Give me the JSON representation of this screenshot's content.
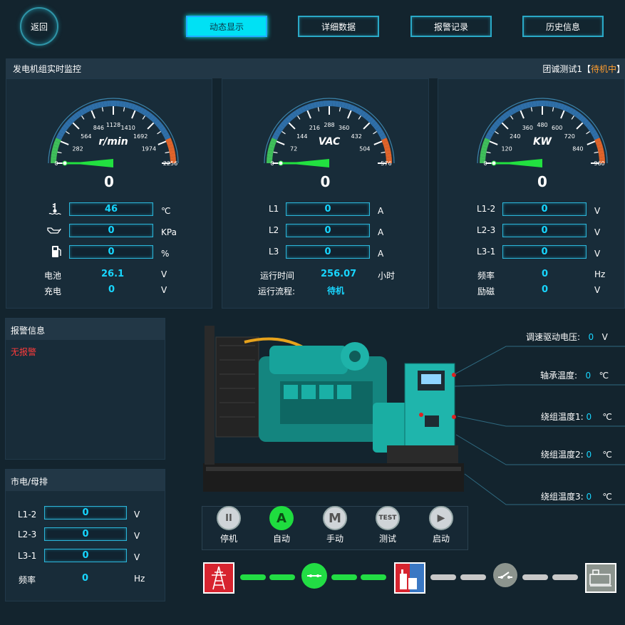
{
  "nav": {
    "back": "返回",
    "tabs": [
      {
        "label": "动态显示",
        "active": true
      },
      {
        "label": "详细数据"
      },
      {
        "label": "报警记录"
      },
      {
        "label": "历史信息"
      }
    ]
  },
  "monitor": {
    "title": "发电机组实时监控",
    "unit_name": "团诚测试1",
    "bracket_open": "【",
    "status": "待机中",
    "bracket_close": "】"
  },
  "gauges": [
    {
      "unit": "r/min",
      "ticks": [
        "0",
        "282",
        "564",
        "846",
        "1128",
        "1410",
        "1692",
        "1974",
        "2256"
      ],
      "value": "0",
      "needle": 0
    },
    {
      "unit": "VAC",
      "ticks": [
        "0",
        "72",
        "144",
        "216",
        "288",
        "360",
        "432",
        "504",
        "576"
      ],
      "value": "0",
      "needle": 0
    },
    {
      "unit": "KW",
      "ticks": [
        "0",
        "120",
        "240",
        "360",
        "480",
        "600",
        "720",
        "840",
        "960"
      ],
      "value": "0",
      "needle": 0
    }
  ],
  "engine": {
    "rows": [
      {
        "icon": "coolant-temp-icon",
        "value": "46",
        "unit": "℃"
      },
      {
        "icon": "oil-pressure-icon",
        "value": "0",
        "unit": "KPa"
      },
      {
        "icon": "fuel-icon",
        "value": "0",
        "unit": "%"
      }
    ],
    "battery_label": "电池",
    "battery_value": "26.1",
    "battery_unit": "V",
    "charge_label": "充电",
    "charge_value": "0",
    "charge_unit": "V"
  },
  "current": {
    "rows": [
      {
        "label": "L1",
        "value": "0",
        "unit": "A"
      },
      {
        "label": "L2",
        "value": "0",
        "unit": "A"
      },
      {
        "label": "L3",
        "value": "0",
        "unit": "A"
      }
    ],
    "runtime_label": "运行时间",
    "runtime_value": "256.07",
    "runtime_unit": "小时",
    "flow_label": "运行流程:",
    "flow_value": "待机"
  },
  "voltage": {
    "rows": [
      {
        "label": "L1-2",
        "value": "0",
        "unit": "V"
      },
      {
        "label": "L2-3",
        "value": "0",
        "unit": "V"
      },
      {
        "label": "L3-1",
        "value": "0",
        "unit": "V"
      }
    ],
    "freq_label": "频率",
    "freq_value": "0",
    "freq_unit": "Hz",
    "excite_label": "励磁",
    "excite_value": "0",
    "excite_unit": "V"
  },
  "alarm": {
    "title": "报警信息",
    "text": "无报警"
  },
  "mains": {
    "title": "市电/母排",
    "rows": [
      {
        "label": "L1-2",
        "value": "0",
        "unit": "V"
      },
      {
        "label": "L2-3",
        "value": "0",
        "unit": "V"
      },
      {
        "label": "L3-1",
        "value": "0",
        "unit": "V"
      }
    ],
    "freq_label": "频率",
    "freq_value": "0",
    "freq_unit": "Hz"
  },
  "callouts": [
    {
      "label": "调速驱动电压:",
      "value": "0",
      "unit": "V"
    },
    {
      "label": "轴承温度:",
      "value": "0",
      "unit": "℃"
    },
    {
      "label": "绕组温度1:",
      "value": "0",
      "unit": "℃"
    },
    {
      "label": "绕组温度2:",
      "value": "0",
      "unit": "℃"
    },
    {
      "label": "绕组温度3:",
      "value": "0",
      "unit": "℃"
    }
  ],
  "controls": [
    {
      "icon": "pause-icon",
      "glyph": "II",
      "label": "停机"
    },
    {
      "icon": "auto-icon",
      "glyph": "A",
      "label": "自动"
    },
    {
      "icon": "manual-icon",
      "glyph": "M",
      "label": "手动"
    },
    {
      "icon": "test-icon",
      "glyph": "TEST",
      "label": "测试"
    },
    {
      "icon": "play-icon",
      "glyph": "▶",
      "label": "启动"
    }
  ],
  "colors": {
    "accent": "#00e1f4",
    "value": "#18d6ff",
    "status": "#ff9d2e",
    "alarm": "#ff3b3b",
    "active_line": "#22dd44",
    "inactive_line": "#c8c8c8"
  }
}
